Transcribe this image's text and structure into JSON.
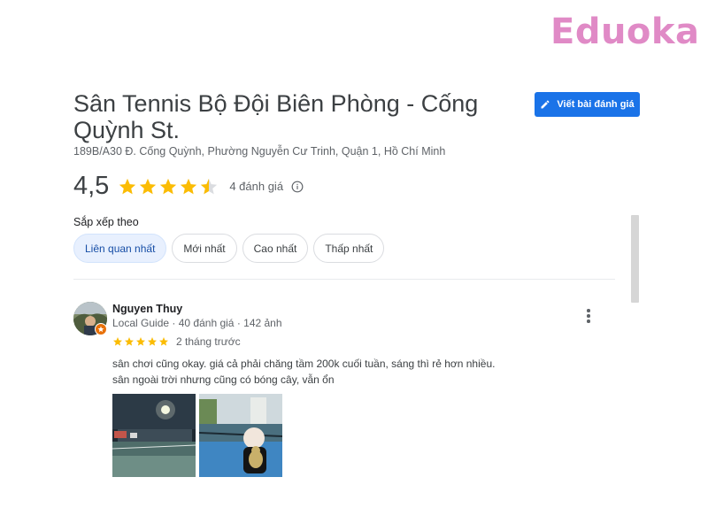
{
  "brand": {
    "logo_text": "Eduoka",
    "color": "#e08ac6"
  },
  "place": {
    "title": "Sân Tennis Bộ Đội Biên Phòng - Cống Quỳnh St.",
    "address": "189B/A30 Đ. Cống Quỳnh, Phường Nguyễn Cư Trinh, Quận 1, Hồ Chí Minh"
  },
  "write_review": {
    "label": "Viết bài đánh giá",
    "icon": "pencil-icon",
    "color": "#1a73e8"
  },
  "rating": {
    "value": "4,5",
    "stars": 4.5,
    "count_text": "4 đánh giá",
    "star_color": "#fbbc04",
    "info_icon": "info-icon"
  },
  "sort": {
    "label": "Sắp xếp theo",
    "options": [
      "Liên quan nhất",
      "Mới nhất",
      "Cao nhất",
      "Thấp nhất"
    ],
    "selected": "Liên quan nhất"
  },
  "review": {
    "author": "Nguyen Thuy",
    "guide_label": "Local Guide",
    "reviews_count": "40 đánh giá",
    "photos_count": "142 ảnh",
    "stars": 5,
    "time": "2 tháng trước",
    "text_line1": "sân chơi cũng okay. giá cả phải chăng tầm 200k cuối tuần, sáng thì rẻ hơn nhiều.",
    "text_line2": "sân ngoài trời nhưng cũng có bóng cây, vẫn ổn",
    "photos": [
      "night-tennis-court-photo",
      "court-with-plush-toy-photo"
    ]
  }
}
